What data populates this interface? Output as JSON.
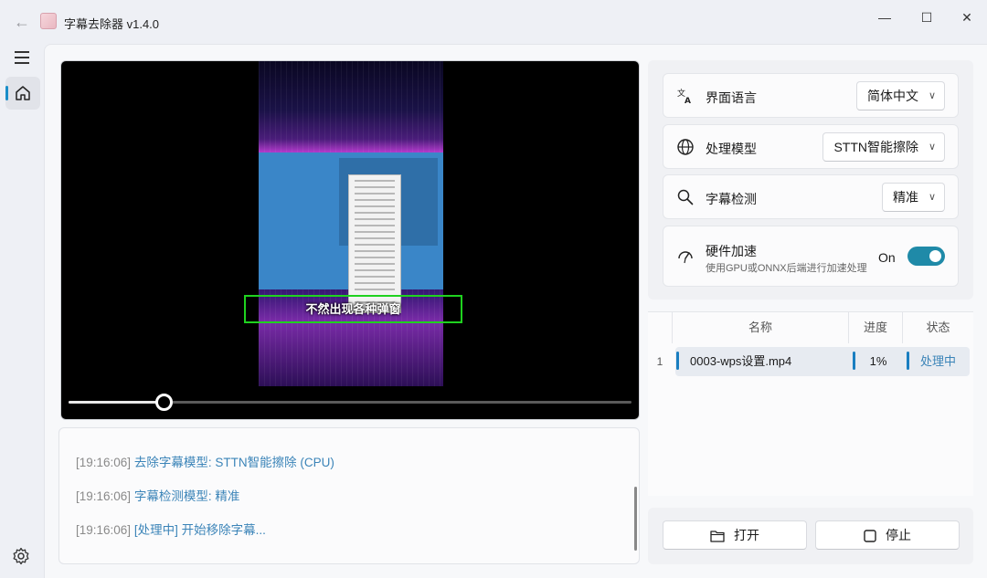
{
  "window": {
    "title": "字幕去除器 v1.4.0"
  },
  "video": {
    "subtitle_text": "不然出现各种弹窗",
    "progress": 0.17
  },
  "log": {
    "lines": [
      {
        "time": "[19:16:06]",
        "msg": "去除字幕模型: STTN智能擦除 (CPU)"
      },
      {
        "time": "[19:16:06]",
        "msg": "字幕检测模型: 精准"
      },
      {
        "time": "[19:16:06]",
        "msg": "[处理中] 开始移除字幕..."
      }
    ]
  },
  "settings": {
    "language": {
      "label": "界面语言",
      "value": "简体中文"
    },
    "model": {
      "label": "处理模型",
      "value": "STTN智能擦除"
    },
    "detection": {
      "label": "字幕检测",
      "value": "精准"
    },
    "hardware": {
      "label": "硬件加速",
      "desc": "使用GPU或ONNX后端进行加速处理",
      "state": "On",
      "enabled": true
    }
  },
  "table": {
    "headers": {
      "name": "名称",
      "progress": "进度",
      "status": "状态"
    },
    "rows": [
      {
        "index": "1",
        "name": "0003-wps设置.mp4",
        "progress": "1%",
        "status": "处理中"
      }
    ]
  },
  "buttons": {
    "open": "打开",
    "stop": "停止"
  },
  "colors": {
    "accent": "#1f8aa8",
    "link": "#3b84b8",
    "subtitle_box": "#1fd21f"
  }
}
